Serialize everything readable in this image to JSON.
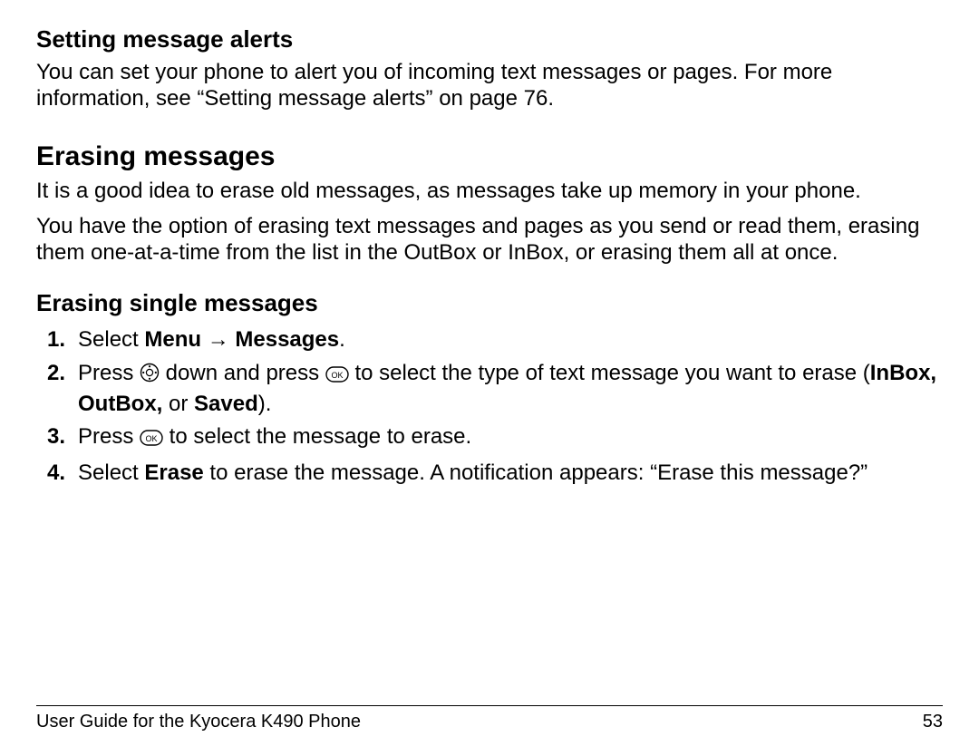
{
  "section1": {
    "heading": "Setting message alerts",
    "para": "You can set your phone to alert you of incoming text messages or pages. For more information, see “Setting message alerts” on page 76."
  },
  "section2": {
    "heading": "Erasing messages",
    "para1": "It is a good idea to erase old messages, as messages take up memory in your phone.",
    "para2": "You have the option of erasing text messages and pages as you send or read them, erasing them one-at-a-time from the list in the OutBox or InBox, or erasing them all at once."
  },
  "section3": {
    "heading": "Erasing single messages",
    "step1_pre": "Select ",
    "step1_menu": "Menu",
    "step1_arrow": " → ",
    "step1_messages": "Messages",
    "step1_post": ".",
    "step2_a": "Press ",
    "step2_b": " down and press ",
    "step2_c": " to select the type of text message you want to erase (",
    "step2_bold": "InBox, OutBox,",
    "step2_d": " or ",
    "step2_bold2": "Saved",
    "step2_e": ").",
    "step3_a": "Press ",
    "step3_b": " to select the message to erase.",
    "step4_a": "Select ",
    "step4_bold": "Erase",
    "step4_b": " to erase the message. A notification appears: “Erase this message?”"
  },
  "footer": {
    "left": "User Guide for the Kyocera K490 Phone",
    "right": "53"
  }
}
